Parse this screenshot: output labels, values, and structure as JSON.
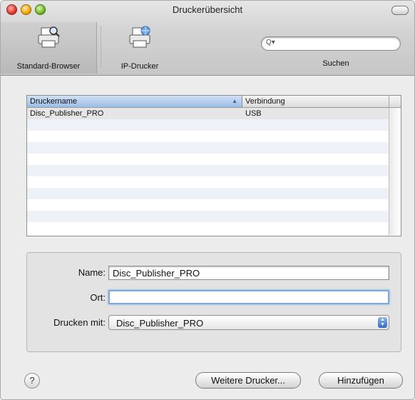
{
  "window": {
    "title": "Druckerübersicht"
  },
  "toolbar": {
    "items": [
      {
        "label": "Standard-Browser",
        "icon": "printer-magnifier-icon",
        "selected": true
      },
      {
        "label": "IP-Drucker",
        "icon": "printer-globe-icon",
        "selected": false
      }
    ],
    "search": {
      "label": "Suchen",
      "placeholder": "",
      "icon": "search-icon"
    }
  },
  "table": {
    "columns": [
      "Druckername",
      "Verbindung"
    ],
    "sort_column": "Druckername",
    "sort_direction": "ascending",
    "rows": [
      {
        "name": "Disc_Publisher_PRO",
        "connection": "USB"
      }
    ]
  },
  "details": {
    "name_label": "Name:",
    "name_value": "Disc_Publisher_PRO",
    "location_label": "Ort:",
    "location_value": "",
    "print_with_label": "Drucken mit:",
    "print_with_value": "Disc_Publisher_PRO"
  },
  "buttons": {
    "help": "?",
    "more_printers": "Weitere Drucker...",
    "add": "Hinzufügen"
  },
  "colors": {
    "selection_blue": "#9bbde6",
    "focus_ring": "#7fa7dc"
  }
}
